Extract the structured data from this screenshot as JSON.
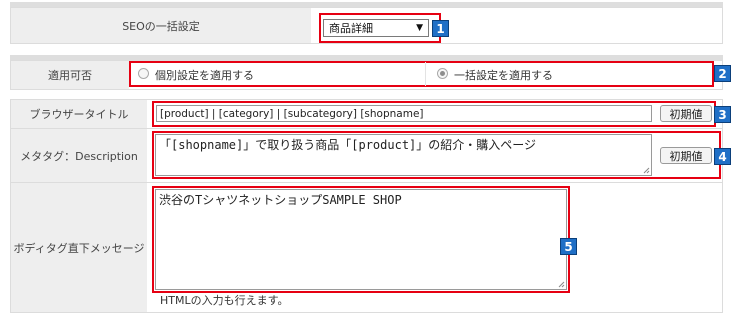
{
  "seo": {
    "label": "SEOの一括設定",
    "select_value": "商品詳細",
    "select_arrow": "▼",
    "badge": "1"
  },
  "apply": {
    "label": "適用可否",
    "option_individual": "個別設定を適用する",
    "option_bulk": "一括設定を適用する",
    "selected": "一括設定を適用する",
    "badge": "2"
  },
  "browser_title": {
    "label": "ブラウザータイトル",
    "value": "[product] | [category] | [subcategory] [shopname]",
    "reset_label": "初期値",
    "badge": "3"
  },
  "meta_description": {
    "label": "メタタグ：Description",
    "value": "「[shopname]」で取り扱う商品「[product]」の紹介・購入ページ",
    "reset_label": "初期値",
    "badge": "4"
  },
  "body_message": {
    "label": "ボディタグ直下メッセージ",
    "value": "渋谷のTシャツネットショップSAMPLE SHOP",
    "note": "HTMLの入力も行えます。",
    "badge": "5"
  },
  "colors": {
    "highlight": "#e60012",
    "badge": "#1f6fc6",
    "label_bg": "#eeeeee"
  }
}
